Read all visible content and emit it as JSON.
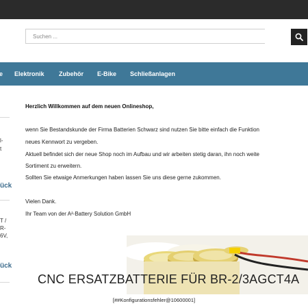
{
  "search": {
    "placeholder": "Suchen ..."
  },
  "nav": {
    "items": [
      {
        "label": "e"
      },
      {
        "label": "Elektronik"
      },
      {
        "label": "Zubehör"
      },
      {
        "label": "E-Bike"
      },
      {
        "label": "Schließanlagen"
      }
    ]
  },
  "sidebar": {
    "snippet1": "l-",
    "snippet2": "t",
    "back_link_1": "ück",
    "snippet3": "T /",
    "snippet4": "R-",
    "snippet5": "6V,",
    "back_link_2": "ück"
  },
  "content": {
    "title": "Herzlich Willkommen auf dem neuen Onlineshop,",
    "line1": "wenn Sie Bestandskunde der Firma Batterien Schwarz sind nutzen Sie bitte einfach die Funktion",
    "line2": "neues Kennwort zu vergeben.",
    "line3": "Aktuell befindet sich der neue Shop noch im Aufbau und wir arbeiten stetig daran, ihn noch weite",
    "line4": "Sortiment zu erweitern.",
    "line5": "Sollten Sie etwaige Anmerkungen haben lassen Sie uns diese gerne zukommen.",
    "line6": "Vielen Dank.",
    "line7": "Ihr Team von der A²-Battery Solution GmbH"
  },
  "product": {
    "title": "CNC ERSATZBATTERIE FÜR BR-2/3AGCT4A"
  },
  "footer": {
    "config_error": "[##Konfigurationsfehler@10600001]"
  },
  "colors": {
    "topbar": "#2b2b2b",
    "nav": "#3f7898",
    "link": "#3f6e8e"
  }
}
